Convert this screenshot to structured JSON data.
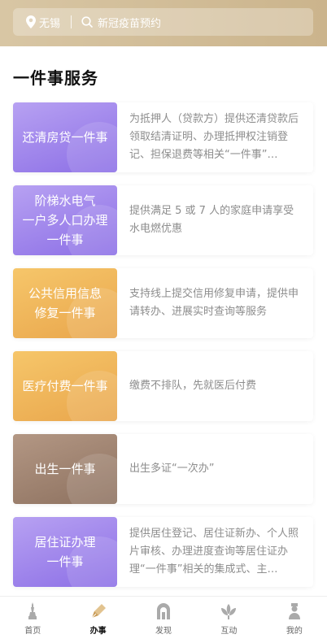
{
  "colors": {
    "header": "#cbb48c",
    "accent_active": "#c89a55",
    "inactive_icon": "#aaaaaa"
  },
  "header": {
    "location": "无锡",
    "search_placeholder": "新冠疫苗预约",
    "location_icon": "location-pin-icon",
    "search_icon": "search-icon"
  },
  "page_title": "一件事服务",
  "services": [
    {
      "title": "还清房贷一件事",
      "theme": "purple",
      "desc": "为抵押人（贷款方）提供还清贷款后领取结清证明、办理抵押权注销登记、担保退费等相关“一件事”…"
    },
    {
      "title": "阶梯水电气\n一户多人口办理\n一件事",
      "theme": "purple",
      "desc": "提供满足 5 或 7 人的家庭申请享受水电燃优惠"
    },
    {
      "title": "公共信用信息\n修复一件事",
      "theme": "gold",
      "desc": "支持线上提交信用修复申请，提供申请转办、进展实时查询等服务"
    },
    {
      "title": "医疗付费一件事",
      "theme": "gold",
      "desc": "缴费不排队，先就医后付费"
    },
    {
      "title": "出生一件事",
      "theme": "brown",
      "desc": "出生多证“一次办”"
    },
    {
      "title": "居住证办理\n一件事",
      "theme": "purple",
      "desc": "提供居住登记、居住证新办、个人照片审核、办理进度查询等居住证办理“一件事”相关的集成式、主…"
    }
  ],
  "tabbar": {
    "tabs": [
      {
        "label": "首页",
        "icon": "home-tower-icon",
        "active": false
      },
      {
        "label": "办事",
        "icon": "pen-icon",
        "active": true
      },
      {
        "label": "发现",
        "icon": "arch-icon",
        "active": false
      },
      {
        "label": "互动",
        "icon": "lotus-icon",
        "active": false
      },
      {
        "label": "我的",
        "icon": "profile-icon",
        "active": false
      }
    ]
  }
}
